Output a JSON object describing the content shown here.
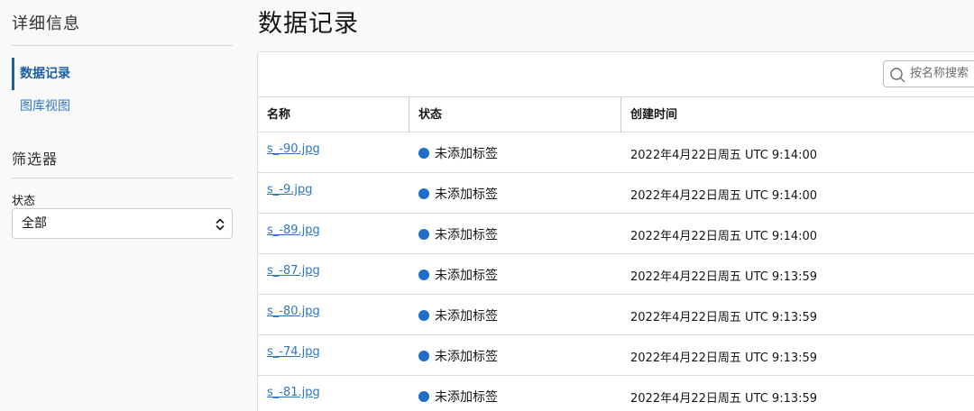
{
  "sidebar": {
    "details_heading": "详细信息",
    "nav": [
      {
        "label": "数据记录",
        "active": true
      },
      {
        "label": "图库视图",
        "active": false
      }
    ],
    "filters_heading": "筛选器",
    "status_filter": {
      "label": "状态",
      "value": "全部"
    }
  },
  "main": {
    "title": "数据记录",
    "search": {
      "placeholder": "按名称搜索"
    },
    "table": {
      "columns": [
        "名称",
        "状态",
        "创建时间"
      ],
      "rows": [
        {
          "name": "s_-90.jpg",
          "status": "未添加标签",
          "created": "2022年4月22日周五 UTC 9:14:00"
        },
        {
          "name": "s_-9.jpg",
          "status": "未添加标签",
          "created": "2022年4月22日周五 UTC 9:14:00"
        },
        {
          "name": "s_-89.jpg",
          "status": "未添加标签",
          "created": "2022年4月22日周五 UTC 9:14:00"
        },
        {
          "name": "s_-87.jpg",
          "status": "未添加标签",
          "created": "2022年4月22日周五 UTC 9:13:59"
        },
        {
          "name": "s_-80.jpg",
          "status": "未添加标签",
          "created": "2022年4月22日周五 UTC 9:13:59"
        },
        {
          "name": "s_-74.jpg",
          "status": "未添加标签",
          "created": "2022年4月22日周五 UTC 9:13:59"
        },
        {
          "name": "s_-81.jpg",
          "status": "未添加标签",
          "created": "2022年4月22日周五 UTC 9:13:59"
        }
      ]
    }
  },
  "colors": {
    "accent": "#2c75c2",
    "status_dot": "#1f6fc9"
  },
  "icons": {
    "search": "search-icon",
    "select": "chevron-up-down-icon",
    "status": "status-dot-icon"
  }
}
